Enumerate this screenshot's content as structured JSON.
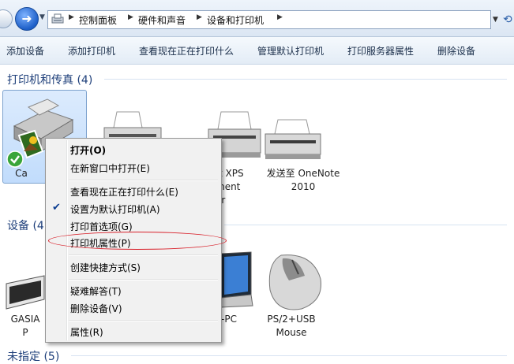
{
  "address_bar": {
    "crumbs": [
      "控制面板",
      "硬件和声音",
      "设备和打印机"
    ]
  },
  "toolbar": {
    "items": [
      "添加设备",
      "添加打印机",
      "查看现在正在打印什么",
      "管理默认打印机",
      "打印服务器属性",
      "删除设备"
    ]
  },
  "groups": {
    "printers": "打印机和传真 (4)",
    "devices": "设备 (4",
    "unspecified": "未指定 (5)"
  },
  "printers": [
    {
      "label": "Ca"
    },
    {
      "label": ""
    },
    {
      "label": "ft XPS\nment\ner"
    },
    {
      "label": "发送至 OneNote\n2010"
    }
  ],
  "devices": [
    {
      "label": "GASIA\nP"
    },
    {
      "label": "-PC"
    },
    {
      "label": "PS/2+USB\nMouse"
    }
  ],
  "context_menu": {
    "items": [
      {
        "label": "打开(O)",
        "bold": true
      },
      {
        "label": "在新窗口中打开(E)"
      },
      {
        "label": "查看现在正在打印什么(E)"
      },
      {
        "label": "设置为默认打印机(A)",
        "checked": true
      },
      {
        "label": "打印首选项(G)"
      },
      {
        "label": "打印机属性(P)",
        "circled": true
      },
      {
        "label": "创建快捷方式(S)"
      },
      {
        "label": "疑难解答(T)"
      },
      {
        "label": "删除设备(V)"
      },
      {
        "label": "属性(R)"
      }
    ]
  },
  "colors": {
    "group_header": "#1e3f7a",
    "selection": "#c1dcfc",
    "annotation": "#d8202a"
  },
  "icons": [
    "back-arrow-icon",
    "forward-arrow-icon",
    "devices-folder-icon",
    "refresh-icon",
    "printer-icon",
    "default-check-icon",
    "keyboard-icon",
    "laptop-icon",
    "mouse-icon",
    "checkmark-icon"
  ]
}
